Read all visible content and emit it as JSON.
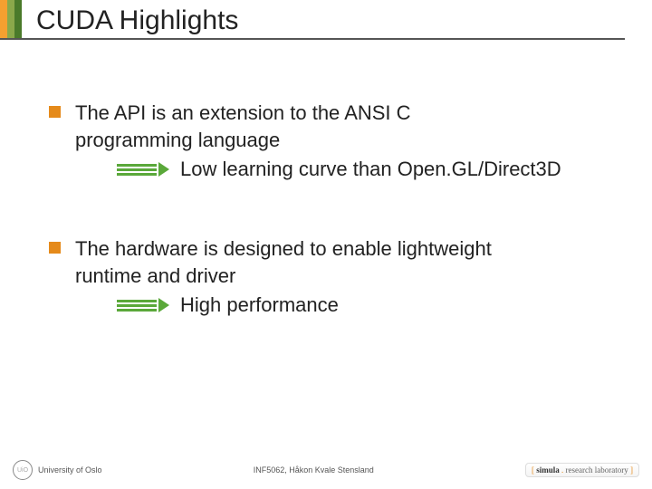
{
  "title": "CUDA Highlights",
  "bullets": {
    "b1": {
      "line1": "The API is an extension to the ANSI C",
      "line2": "programming language",
      "sub": "Low learning curve than Open.GL/Direct3D"
    },
    "b2": {
      "line1": "The hardware is designed to enable lightweight",
      "line2": "runtime and driver",
      "sub": "High performance"
    }
  },
  "footer": {
    "left": "University of Oslo",
    "mid": "INF5062, Håkon Kvale Stensland",
    "right": {
      "b1": "[ ",
      "name": "simula",
      "dot": " . ",
      "lab": "research laboratory ",
      "b2": "]"
    }
  }
}
